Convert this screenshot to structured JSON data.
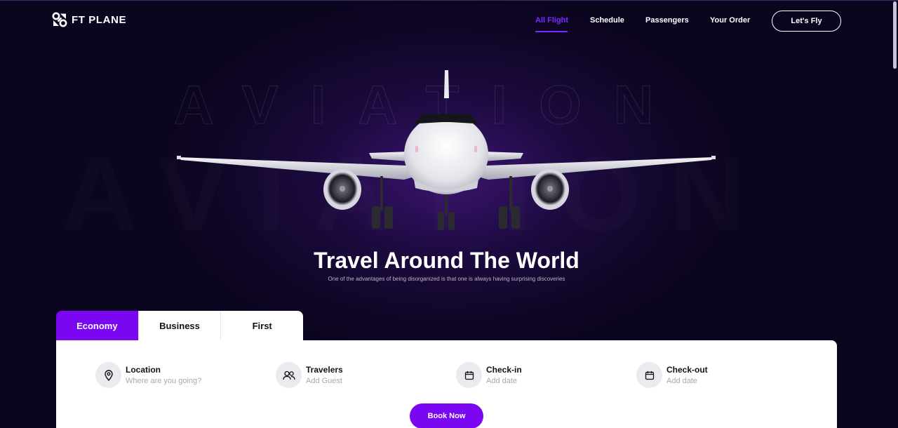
{
  "brand": {
    "name": "FT PLANE"
  },
  "nav": {
    "items": [
      {
        "label": "All Flight",
        "active": true
      },
      {
        "label": "Schedule",
        "active": false
      },
      {
        "label": "Passengers",
        "active": false
      },
      {
        "label": "Your Order",
        "active": false
      }
    ],
    "cta_label": "Let's Fly"
  },
  "hero": {
    "background_word": "AVIATION",
    "title": "Travel Around The World",
    "subtitle": "One of the advantages of being disorganized is that one is always having surprising discoveries"
  },
  "booking": {
    "tabs": [
      {
        "label": "Economy",
        "active": true
      },
      {
        "label": "Business",
        "active": false
      },
      {
        "label": "First",
        "active": false
      }
    ],
    "fields": [
      {
        "label": "Location",
        "placeholder": "Where are you going?",
        "icon": "map-pin-icon"
      },
      {
        "label": "Travelers",
        "placeholder": "Add Guest",
        "icon": "users-icon"
      },
      {
        "label": "Check-in",
        "placeholder": "Add date",
        "icon": "calendar-icon"
      },
      {
        "label": "Check-out",
        "placeholder": "Add date",
        "icon": "calendar-icon"
      }
    ],
    "submit_label": "Book Now"
  },
  "colors": {
    "accent": "#7a06f2",
    "background": "#0c0520",
    "nav_active": "#7a2cff"
  }
}
